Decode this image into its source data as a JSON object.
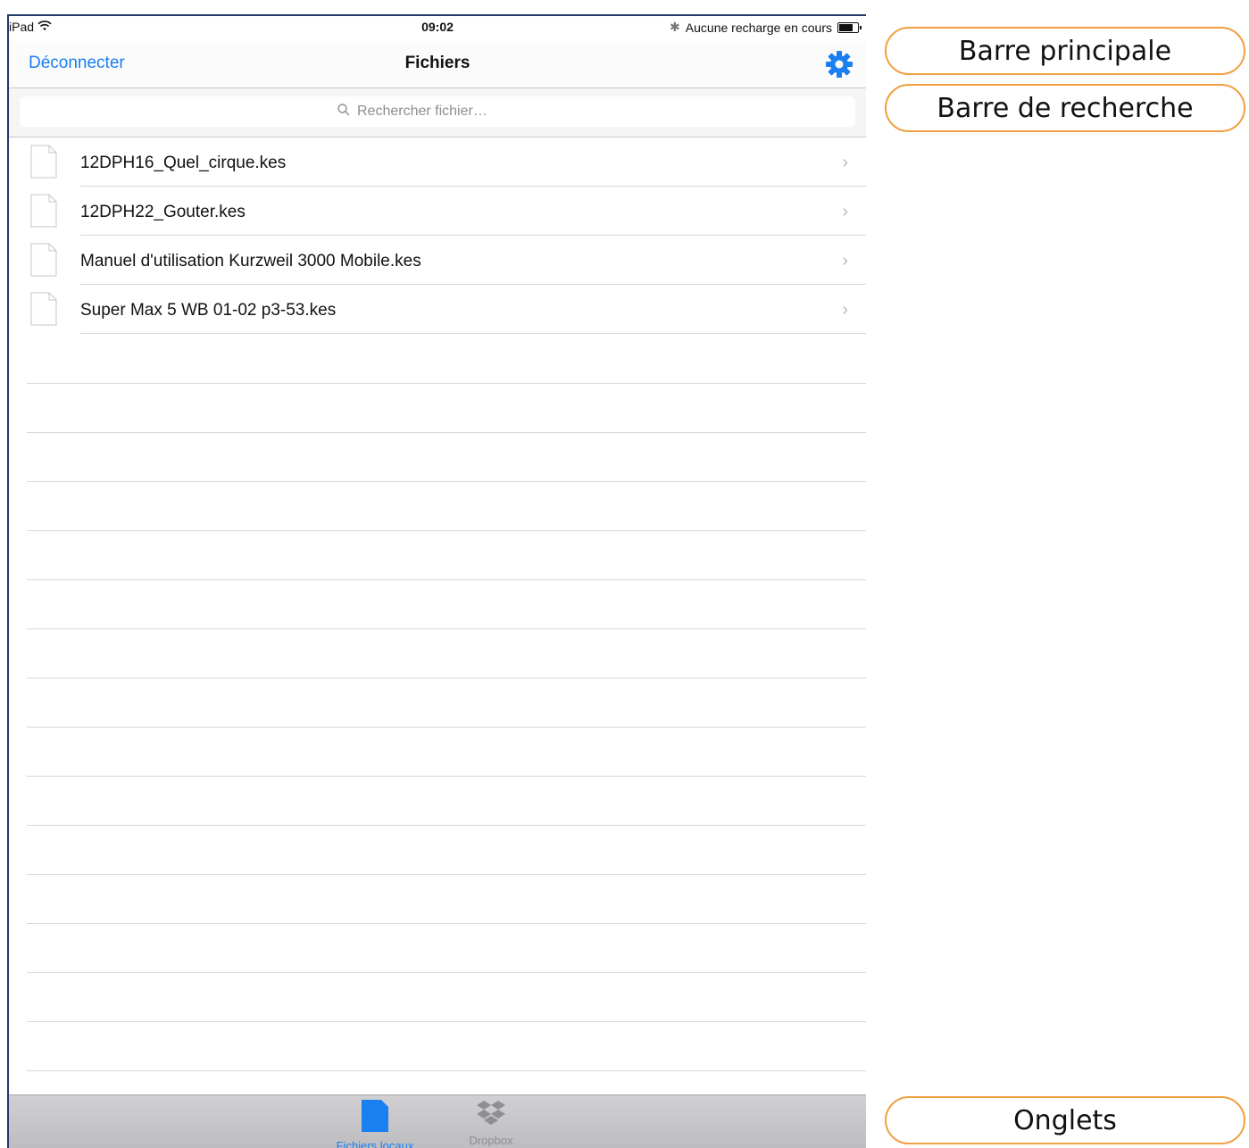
{
  "statusbar": {
    "device": "iPad",
    "wifi_icon": "wifi-icon",
    "time": "09:02",
    "bluetooth_icon": "bluetooth-icon",
    "charging_text": "Aucune recharge en cours",
    "battery_icon": "battery-icon",
    "battery_level": 0.75
  },
  "navbar": {
    "left_label": "Déconnecter",
    "title": "Fichiers",
    "settings_icon": "gear-icon"
  },
  "search": {
    "placeholder": "Rechercher fichier…",
    "value": "",
    "icon": "search-icon"
  },
  "files": [
    {
      "name": "12DPH16_Quel_cirque.kes"
    },
    {
      "name": "12DPH22_Gouter.kes"
    },
    {
      "name": "Manuel d'utilisation Kurzweil 3000 Mobile.kes"
    },
    {
      "name": "Super Max 5 WB 01-02 p3-53.kes"
    }
  ],
  "tabbar": {
    "tabs": [
      {
        "label": "Fichiers locaux",
        "icon": "document-icon",
        "selected": true
      },
      {
        "label": "Dropbox",
        "icon": "dropbox-icon",
        "selected": false
      }
    ]
  },
  "annotations": {
    "main_bar": "Barre principale",
    "search_bar": "Barre de recherche",
    "tabs": "Onglets"
  },
  "colors": {
    "accent": "#1a7ff0",
    "annotation_border": "#f0a040",
    "frame": "#1f3b66"
  }
}
